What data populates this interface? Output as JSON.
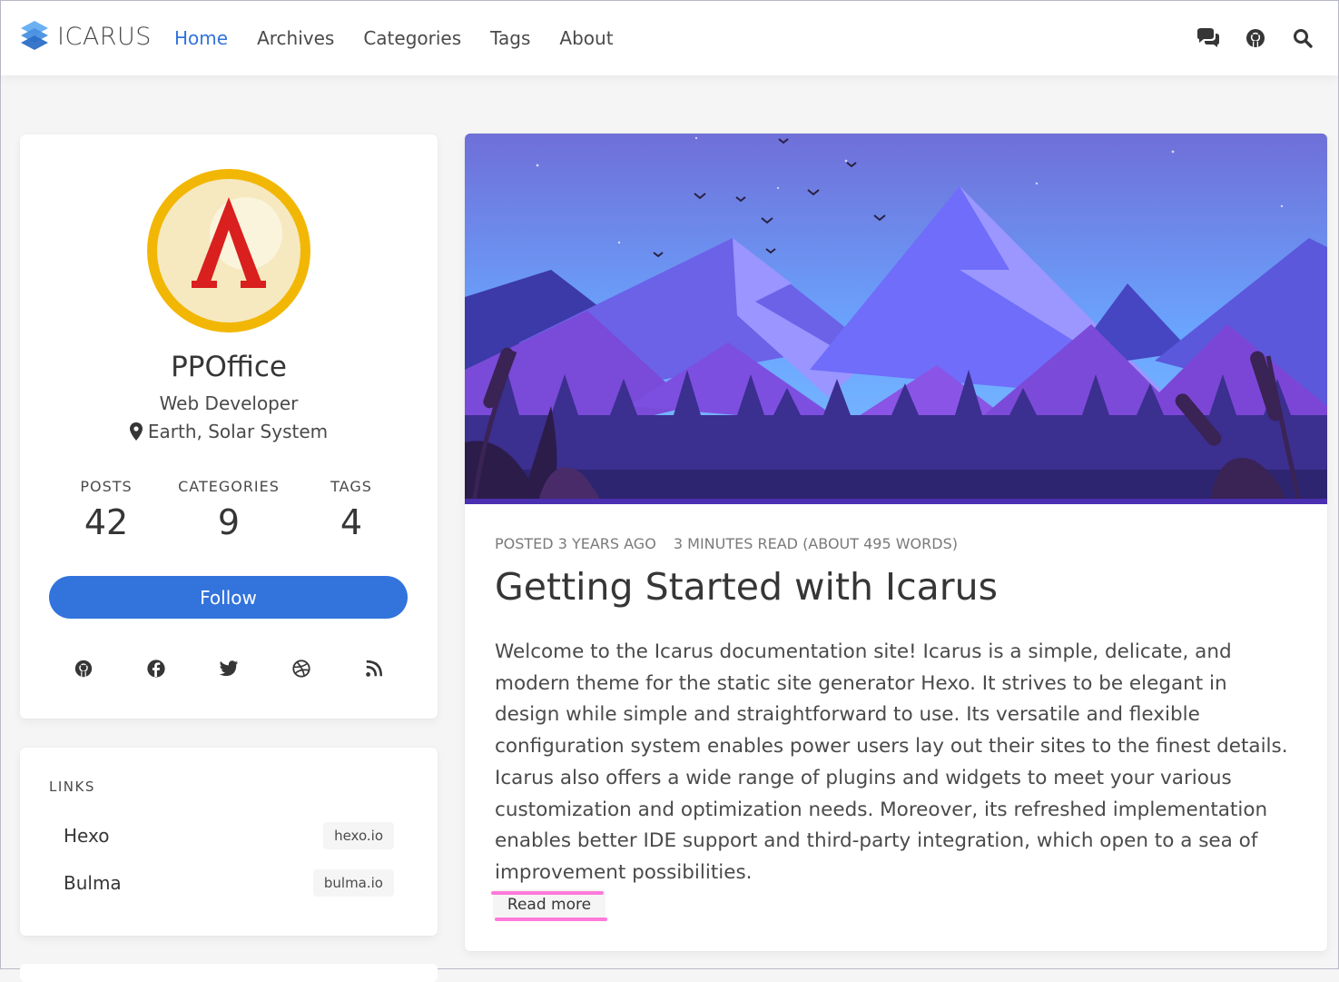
{
  "nav": {
    "brand": "ICARUS",
    "links": [
      "Home",
      "Archives",
      "Categories",
      "Tags",
      "About"
    ],
    "active": "Home",
    "icons": [
      "comments-icon",
      "github-icon",
      "search-icon"
    ]
  },
  "profile": {
    "name": "PPOffice",
    "title": "Web Developer",
    "location": "Earth, Solar System",
    "stats": [
      {
        "label": "POSTS",
        "value": "42"
      },
      {
        "label": "CATEGORIES",
        "value": "9"
      },
      {
        "label": "TAGS",
        "value": "4"
      }
    ],
    "follow_label": "Follow",
    "socials": [
      "github-icon",
      "facebook-icon",
      "twitter-icon",
      "dribbble-icon",
      "rss-icon"
    ]
  },
  "links_widget": {
    "title": "LINKS",
    "items": [
      {
        "name": "Hexo",
        "domain": "hexo.io"
      },
      {
        "name": "Bulma",
        "domain": "bulma.io"
      }
    ]
  },
  "post": {
    "posted": "POSTED 3 YEARS AGO",
    "reading": "3 MINUTES READ (ABOUT 495 WORDS)",
    "title": "Getting Started with Icarus",
    "body": "Welcome to the Icarus documentation site! Icarus is a simple, delicate, and modern theme for the static site generator Hexo. It strives to be elegant in design while simple and straightforward to use. Its versatile and flexible configuration system enables power users lay out their sites to the finest details. Icarus also offers a wide range of plugins and widgets to meet your various customization and optimization needs. Moreover, its refreshed implementation enables better IDE support and third-party integration, which open to a sea of improvement possibilities.",
    "read_more": "Read more"
  },
  "colors": {
    "accent": "#3273dc",
    "highlight": "#ff7ad9",
    "background": "#f5f5f5"
  }
}
